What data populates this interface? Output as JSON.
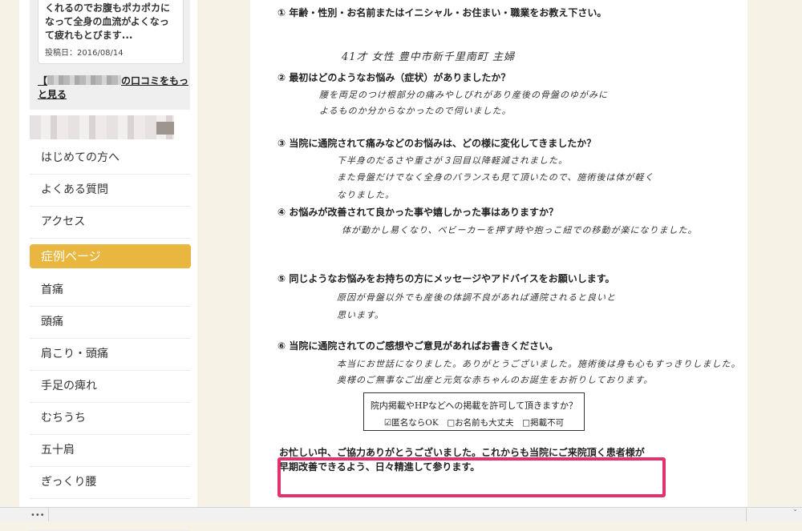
{
  "sidebar": {
    "review": {
      "text": "くれるのでお腹もポカポカになって全身の血流がよくなって疲れもとびます...",
      "date": "投稿日：2016/08/14"
    },
    "more_link_prefix": "【",
    "more_link_suffix": "の口コミをもっと見る",
    "nav_top": [
      "はじめての方へ",
      "よくある質問",
      "アクセス"
    ],
    "case_header": "症例ページ",
    "nav_cases": [
      "首痛",
      "頭痛",
      "肩こり・頭痛",
      "手足の痺れ",
      "むちうち",
      "五十肩",
      "ぎっくり腰",
      "腰痛"
    ]
  },
  "paper": {
    "q1": "① 年齢・性別・お名前またはイニシャル・お住まい・職業をお教え下さい。",
    "a1": "41才 女性 豊中市新千里南町 主婦",
    "q2": "② 最初はどのようなお悩み（症状）がありましたか？",
    "a2": [
      "腰を両足のつけ根部分の痛みやしびれがあり産後の骨盤のゆがみに",
      "よるものか分からなかったので伺いました。"
    ],
    "q3": "③ 当院に通院されて痛みなどのお悩みは、どの様に変化してきましたか？",
    "a3": [
      "下半身のだるさや重さが３回目以降軽減されました。",
      "また骨盤だけでなく全身のバランスも見て頂いたので、施術後は体が軽く",
      "なりました。"
    ],
    "q4": "④ お悩みが改善されて良かった事や嬉しかった事はありますか？",
    "a4": "体が動かし易くなり、ベビーカーを押す時や抱っこ紐での移動が楽になりました。",
    "q5": "⑤ 同じようなお悩みをお持ちの方にメッセージやアドバイスをお願いします。",
    "a5": [
      "原因が骨盤以外でも産後の体調不良があれば通院されると良いと",
      "思います。"
    ],
    "q6": "⑥ 当院に通院されてのご感想やご意見があればお書きください。",
    "a6": [
      "本当にお世話になりました。ありがとうございました。施術後は身も心もすっきりしました。",
      "奥様のご無事なご出産と元気な赤ちゃんのお誕生をお祈りしております。"
    ],
    "consent_question": "院内掲載やHPなどへの掲載を許可して頂きますか？",
    "consent_options": "☑匿名ならOK　□お名前も大丈夫　□掲載不可",
    "closing_line1": "お忙しい中、ご協力ありがとうございました。これからも当院にご来院頂く患者様が",
    "closing_line2": "早期改善できるよう、日々精進して参ります。"
  },
  "bottom_bar": {
    "dots": "•••",
    "glyph": "ˇ"
  },
  "colors": {
    "page_bg": "#f6f2e6",
    "accent_yellow": "#e9b63f",
    "highlight_pink": "#e3316f"
  }
}
